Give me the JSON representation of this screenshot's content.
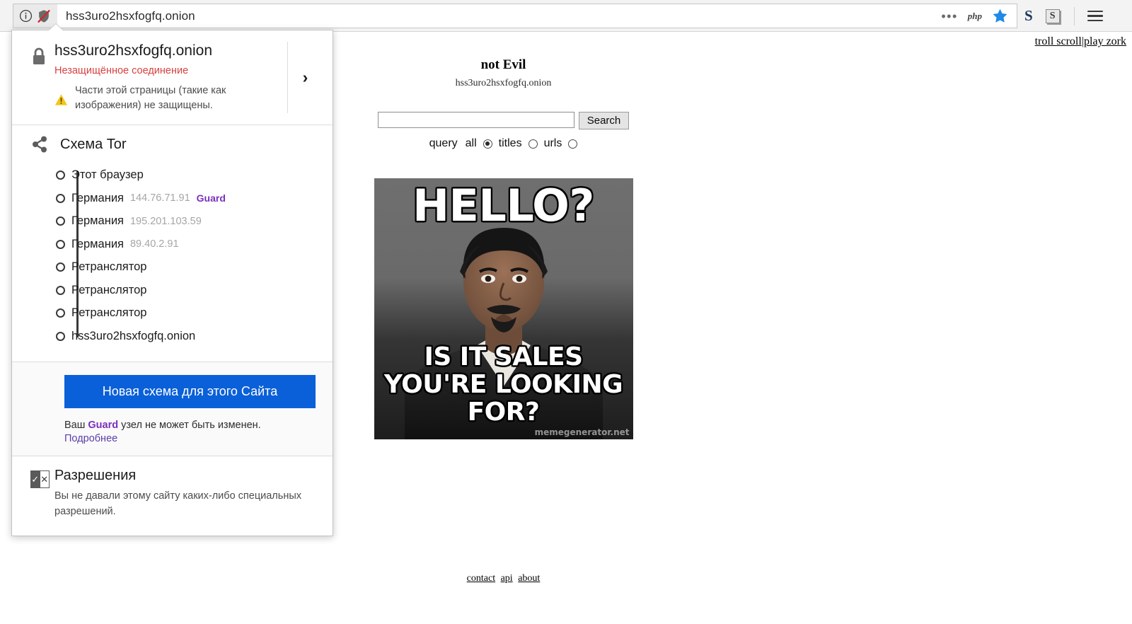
{
  "browser": {
    "url": "hss3uro2hsxfogfq.onion",
    "icons": {
      "info": "info-circle-icon",
      "shield_off": "shield-crossed-icon",
      "more": "three-dots-icon",
      "php": "php",
      "bookmark": "star-icon",
      "ext_s_bold": "S",
      "ext_s_box": "S",
      "menu": "hamburger-icon"
    }
  },
  "identity_panel": {
    "site": {
      "host": "hss3uro2hsxfogfq.onion",
      "connection_status": "Незащищённое соединение",
      "mixed_content": "Части этой страницы (такие как изображения) не защищены.",
      "expand": "›"
    },
    "tor": {
      "title": "Схема Tor",
      "nodes": [
        {
          "label": "Этот браузер",
          "ip": "",
          "badge": ""
        },
        {
          "label": "Германия",
          "ip": "144.76.71.91",
          "badge": "Guard"
        },
        {
          "label": "Германия",
          "ip": "195.201.103.59",
          "badge": ""
        },
        {
          "label": "Германия",
          "ip": "89.40.2.91",
          "badge": ""
        },
        {
          "label": "Ретранслятор",
          "ip": "",
          "badge": ""
        },
        {
          "label": "Ретранслятор",
          "ip": "",
          "badge": ""
        },
        {
          "label": "Ретранслятор",
          "ip": "",
          "badge": ""
        },
        {
          "label": "hss3uro2hsxfogfq.onion",
          "ip": "",
          "badge": ""
        }
      ],
      "new_circuit_button": "Новая схема для этого Сайта",
      "guard_note_pre": "Ваш ",
      "guard_note_bold": "Guard",
      "guard_note_post": " узел не может быть изменен.",
      "learn_more": "Подробнее"
    },
    "permissions": {
      "title": "Разрешения",
      "description": "Вы не давали этому сайту каких-либо специальных разрешений."
    }
  },
  "page": {
    "top_links": {
      "troll": "troll scroll",
      "separator": "|",
      "zork": "play zork"
    },
    "title": "not Evil",
    "subtitle": "hss3uro2hsxfogfq.onion",
    "search": {
      "value": "",
      "placeholder": "",
      "button": "Search"
    },
    "scope": {
      "label": "query",
      "options": [
        {
          "label": "all",
          "selected": true
        },
        {
          "label": "titles",
          "selected": false
        },
        {
          "label": "urls",
          "selected": false
        }
      ]
    },
    "meme": {
      "top_text": "HELLO?",
      "bottom_text": "IS IT SALES YOU'RE LOOKING FOR?",
      "watermark": "memegenerator.net"
    },
    "footer_links": [
      "contact",
      "api",
      "about"
    ]
  },
  "colors": {
    "accent_blue": "#0a60d8",
    "insecure_red": "#d94040",
    "guard_purple": "#7b2fbe",
    "link_purple": "#5b3ea8"
  }
}
